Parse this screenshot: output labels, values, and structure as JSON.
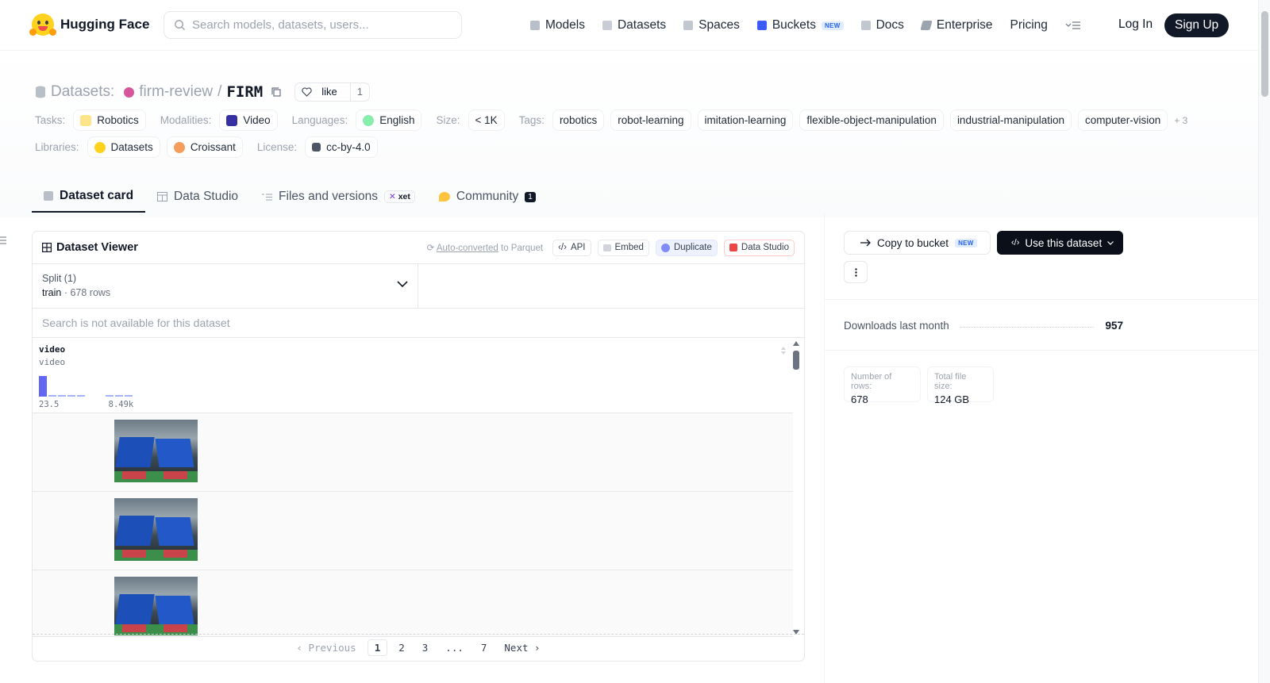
{
  "nav": {
    "brand": "Hugging Face",
    "search_placeholder": "Search models, datasets, users...",
    "links": [
      "Models",
      "Datasets",
      "Spaces",
      "Buckets",
      "Docs",
      "Enterprise",
      "Pricing"
    ],
    "buckets_badge": "NEW",
    "login": "Log In",
    "signup": "Sign Up"
  },
  "header": {
    "prefix": "Datasets:",
    "org": "firm-review",
    "separator": "/",
    "repo": "FIRM",
    "like_label": "like",
    "like_count": "1"
  },
  "meta": {
    "tasks_label": "Tasks:",
    "tasks": [
      "Robotics"
    ],
    "modalities_label": "Modalities:",
    "modalities": [
      "Video"
    ],
    "languages_label": "Languages:",
    "languages": [
      "English"
    ],
    "size_label": "Size:",
    "size": "< 1K",
    "tags_label": "Tags:",
    "tags": [
      "robotics",
      "robot-learning",
      "imitation-learning",
      "flexible-object-manipulation",
      "industrial-manipulation",
      "computer-vision"
    ],
    "tags_more": "+ 3",
    "libraries_label": "Libraries:",
    "libraries": [
      "Datasets",
      "Croissant"
    ],
    "license_label": "License:",
    "license": "cc-by-4.0"
  },
  "tabs": {
    "dataset_card": "Dataset card",
    "data_studio": "Data Studio",
    "files": "Files and versions",
    "xet_badge": "xet",
    "community": "Community",
    "community_count": "1"
  },
  "viewer": {
    "title": "Dataset Viewer",
    "auto_converted_link": "Auto-converted",
    "auto_converted_suffix": "to Parquet",
    "api_label": "API",
    "embed_label": "Embed",
    "duplicate_label": "Duplicate",
    "data_studio_label": "Data Studio",
    "split_label": "Split (1)",
    "split_value": "train",
    "split_rows": "678 rows",
    "search_unavailable": "Search is not available for this dataset",
    "column_name": "video",
    "column_type": "video",
    "hist_min": "23.5",
    "hist_max": "8.49k",
    "pagination": {
      "previous": "Previous",
      "pages": [
        "1",
        "2",
        "3",
        "...",
        "7"
      ],
      "next": "Next",
      "current": "1"
    }
  },
  "sidebar": {
    "copy_to_bucket": "Copy to bucket",
    "copy_badge": "NEW",
    "use_dataset": "Use this dataset",
    "downloads_label": "Downloads last month",
    "downloads_value": "957",
    "rows_label": "Number of rows:",
    "rows_value": "678",
    "filesize_label": "Total file size:",
    "filesize_value": "124 GB"
  }
}
